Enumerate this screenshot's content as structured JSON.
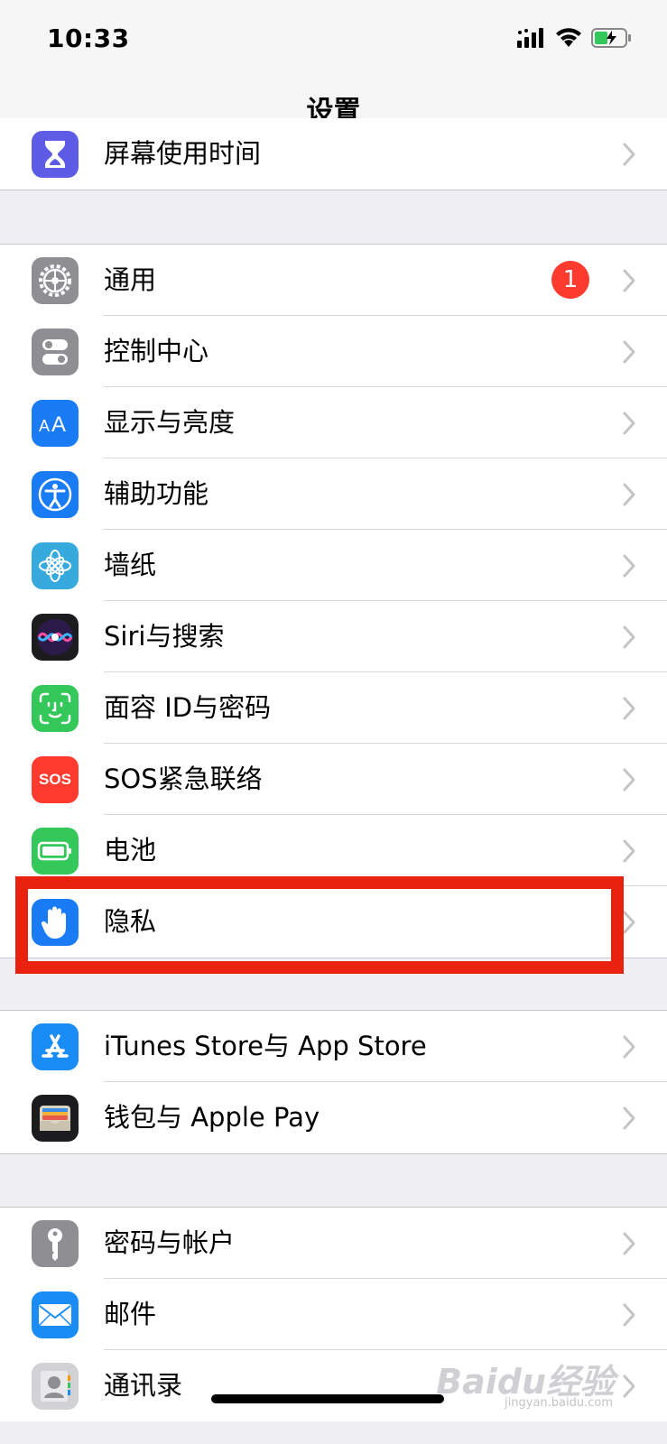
{
  "status_bar": {
    "time": "10:33"
  },
  "nav": {
    "title": "设置"
  },
  "groups": [
    {
      "rows": [
        {
          "label": "屏幕使用时间",
          "icon": "hourglass-icon",
          "color": "#5e5ce6"
        }
      ]
    },
    {
      "rows": [
        {
          "label": "通用",
          "icon": "gear-icon",
          "color": "#8e8e93",
          "badge": "1"
        },
        {
          "label": "控制中心",
          "icon": "toggles-icon",
          "color": "#8e8e93"
        },
        {
          "label": "显示与亮度",
          "icon": "text-size-icon",
          "color": "#1a7cf5"
        },
        {
          "label": "辅助功能",
          "icon": "accessibility-icon",
          "color": "#1a7cf5"
        },
        {
          "label": "墙纸",
          "icon": "flower-icon",
          "color": "#36aadc"
        },
        {
          "label": "Siri与搜索",
          "icon": "siri-icon",
          "color": "#1c1c1e"
        },
        {
          "label": "面容 ID与密码",
          "icon": "face-id-icon",
          "color": "#34c759"
        },
        {
          "label": "SOS紧急联络",
          "icon": "sos-icon",
          "color": "#ff3b30"
        },
        {
          "label": "电池",
          "icon": "battery-icon",
          "color": "#34c759"
        },
        {
          "label": "隐私",
          "icon": "hand-icon",
          "color": "#1a7cf5"
        }
      ]
    },
    {
      "rows": [
        {
          "label": "iTunes Store与 App Store",
          "icon": "app-store-icon",
          "color": "#1a8cf5"
        },
        {
          "label": "钱包与 Apple Pay",
          "icon": "wallet-icon",
          "color": "#1c1c1e"
        }
      ]
    },
    {
      "rows": [
        {
          "label": "密码与帐户",
          "icon": "key-icon",
          "color": "#8e8e93"
        },
        {
          "label": "邮件",
          "icon": "mail-icon",
          "color": "#1a8cf5"
        },
        {
          "label": "通讯录",
          "icon": "contacts-icon",
          "color": "#c7c7cc"
        }
      ]
    }
  ],
  "sos_text": "SOS",
  "watermark": {
    "brand": "Baidu经验",
    "url": "jingyan.baidu.com"
  },
  "highlight_color": "#e8220e"
}
